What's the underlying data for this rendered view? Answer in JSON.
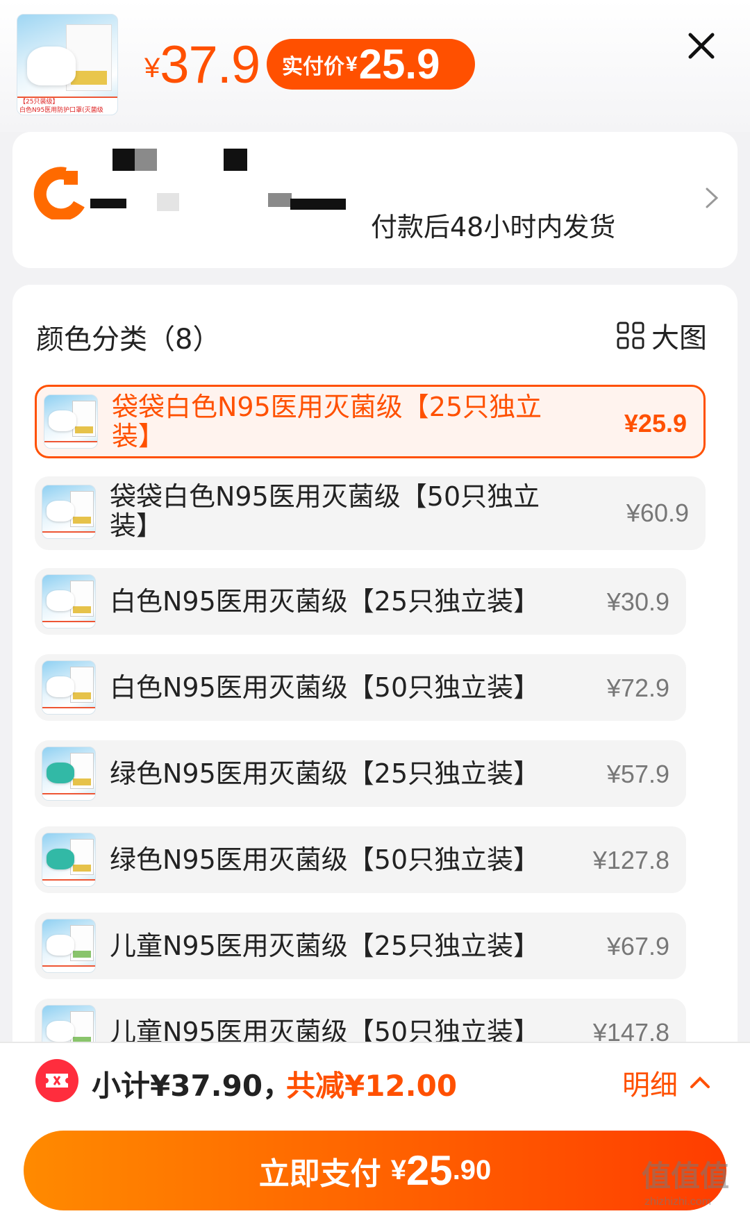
{
  "product": {
    "thumb_band_line1": "【25只装级】",
    "thumb_band_line2": "白色N95医用防护口罩(灭菌级",
    "price_currency": "¥",
    "price": "37.9",
    "pay_label": "实付价",
    "pay_currency": "¥",
    "pay_price": "25.9",
    "close_icon": "close-icon"
  },
  "delivery": {
    "text": "付款后48小时内发货",
    "icon": "shipping-icon",
    "chevron_icon": "chevron-right-icon"
  },
  "variants": {
    "title": "颜色分类（8）",
    "big_image_label": "大图",
    "big_image_icon": "grid-icon",
    "options": [
      {
        "name": "袋袋白色N95医用灭菌级【25只独立装】",
        "price": "¥25.9",
        "selected": true
      },
      {
        "name": "袋袋白色N95医用灭菌级【50只独立装】",
        "price": "¥60.9",
        "selected": false
      },
      {
        "name": "白色N95医用灭菌级【25只独立装】",
        "price": "¥30.9",
        "selected": false
      },
      {
        "name": "白色N95医用灭菌级【50只独立装】",
        "price": "¥72.9",
        "selected": false
      },
      {
        "name": "绿色N95医用灭菌级【25只独立装】",
        "price": "¥57.9",
        "selected": false
      },
      {
        "name": "绿色N95医用灭菌级【50只独立装】",
        "price": "¥127.8",
        "selected": false
      },
      {
        "name": "儿童N95医用灭菌级【25只独立装】",
        "price": "¥67.9",
        "selected": false
      },
      {
        "name": "儿童N95医用灭菌级【50只独立装】",
        "price": "¥147.8",
        "selected": false
      }
    ]
  },
  "footer": {
    "coupon_icon": "coupon-icon",
    "subtotal": "小计¥37.90，",
    "discount": "共减¥12.00",
    "detail_label": "明细",
    "detail_icon": "chevron-up-icon",
    "pay_button_label": "立即支付",
    "pay_button_currency": "¥",
    "pay_button_int": "25",
    "pay_button_dec": ".90",
    "watermark": "值值值",
    "watermark_sub": "zhizhizhi.com"
  },
  "colors": {
    "accent": "#ff5000",
    "pay_gradient_start": "#ff8a00",
    "pay_gradient_end": "#ff3d00"
  }
}
